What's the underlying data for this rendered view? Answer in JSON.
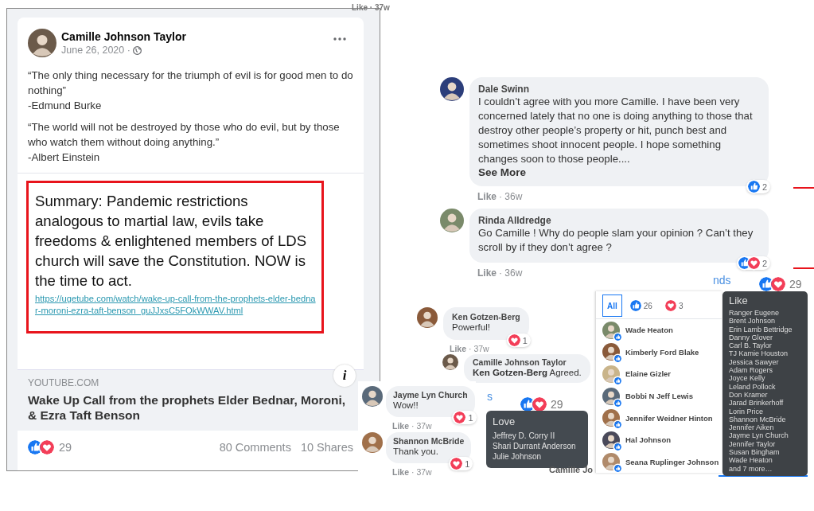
{
  "post": {
    "author": "Camille Johnson Taylor",
    "date": "June 26, 2020 ·",
    "paragraphs": [
      {
        "quote": "“The only thing necessary for the triumph of evil is for good men to do nothing”",
        "attribution": "-Edmund Burke"
      },
      {
        "quote": "“The world will not be destroyed by those who do evil, but by those who watch them without doing anything.”",
        "attribution": "-Albert Einstein"
      }
    ],
    "summary": {
      "text": "Summary:  Pandemic restrictions analogous to martial law, evils take freedoms & enlightened members of LDS church will save the Constitution.  NOW is the time to act.",
      "link": "https://ugetube.com/watch/wake-up-call-from-the-prophets-elder-bednar-moroni-ezra-taft-benson_guJJxsC5FOkWWAV.html"
    },
    "info_badge": "i",
    "link_preview": {
      "domain": "YOUTUBE.COM",
      "title": "Wake Up Call from the prophets Elder Bednar, Moroni, & Ezra Taft Benson"
    },
    "reactions": {
      "like": true,
      "love": true,
      "count": "29"
    },
    "comments": "80 Comments",
    "shares": "10 Shares"
  },
  "comments": [
    {
      "author": "Dale Swinn",
      "text": "I couldn’t agree with you more Camille. I have been very concerned lately that no one is doing anything to those that destroy other people’s property or hit, punch best and sometimes shoot innocent people. I hope something changes soon to those people....",
      "see_more": "See More",
      "like": "Like",
      "time": "· 36w",
      "reactions": {
        "like": true,
        "love": false,
        "count": "2"
      }
    },
    {
      "author": "Rinda Alldredge",
      "text": "Go Camille ! Why do people slam your opinion ? Can’t they scroll by if they don’t agree ?",
      "like": "Like",
      "time": "· 36w",
      "reactions": {
        "like": true,
        "love": true,
        "count": "2"
      }
    }
  ],
  "replies": [
    {
      "author": "Ken Gotzen-Berg",
      "text": "Powerful!",
      "like": "Like",
      "time": "· 37w",
      "reactions": {
        "like": false,
        "love": true,
        "count": "1"
      }
    },
    {
      "author": "Camille Johnson Taylor",
      "mention": "Ken Gotzen-Berg",
      "text": "Agreed."
    }
  ],
  "side_comments": [
    {
      "author": "Jayme Lyn Church",
      "text": "Wow!!",
      "like": "Like",
      "time": "· 37w",
      "reactions": {
        "like": false,
        "love": true,
        "count": "1"
      }
    },
    {
      "author": "Shannon McBride",
      "text": "Thank you.",
      "like": "Like",
      "time": "· 37w",
      "reactions": {
        "like": false,
        "love": true,
        "count": "1"
      }
    }
  ],
  "middle_summary": {
    "like": true,
    "love": true,
    "count": "29"
  },
  "top_summary": {
    "like": true,
    "love": true,
    "count": "29"
  },
  "love_tooltip": {
    "title": "Love",
    "names": [
      "Jeffrey D. Corry II",
      "Shari Durrant Anderson",
      "Julie Johnson"
    ]
  },
  "reactions_dialog": {
    "tabs": [
      {
        "kind": "all",
        "label": "All",
        "selected": true
      },
      {
        "kind": "like",
        "label": "26",
        "selected": false
      },
      {
        "kind": "love",
        "label": "3",
        "selected": false
      }
    ],
    "people": [
      "Wade Heaton",
      "Kimberly Ford Blake",
      "Elaine Gizler",
      "Bobbi N Jeff Lewis",
      "Jennifer Weidner Hinton",
      "Hal Johnson",
      "Seana Ruplinger Johnson"
    ]
  },
  "like_tooltip": {
    "title": "Like",
    "names": [
      "Ranger Eugene",
      "Brent Johnson",
      "Erin Lamb Bettridge",
      "Danny Glover",
      "Carl B. Taylor",
      "TJ Kamie Houston",
      "Jessica Sawyer",
      "Adam Rogers",
      "Joyce Kelly",
      "Leland Pollock",
      "Don Kramer",
      "Jarad Brinkerhoff",
      "Lorin Price",
      "Shannon McBride",
      "Jennifer Aiken",
      "Jayme Lyn Church",
      "Jennifer Taylor",
      "Susan Bingham",
      "Wade Heaton",
      "and 7 more…"
    ]
  },
  "fragments": [
    {
      "kind": "meta",
      "text": "Like · 37w"
    },
    {
      "kind": "link",
      "text": "nds"
    },
    {
      "kind": "link",
      "text": "s"
    },
    {
      "kind": "name",
      "text": "Camille Jo"
    }
  ]
}
